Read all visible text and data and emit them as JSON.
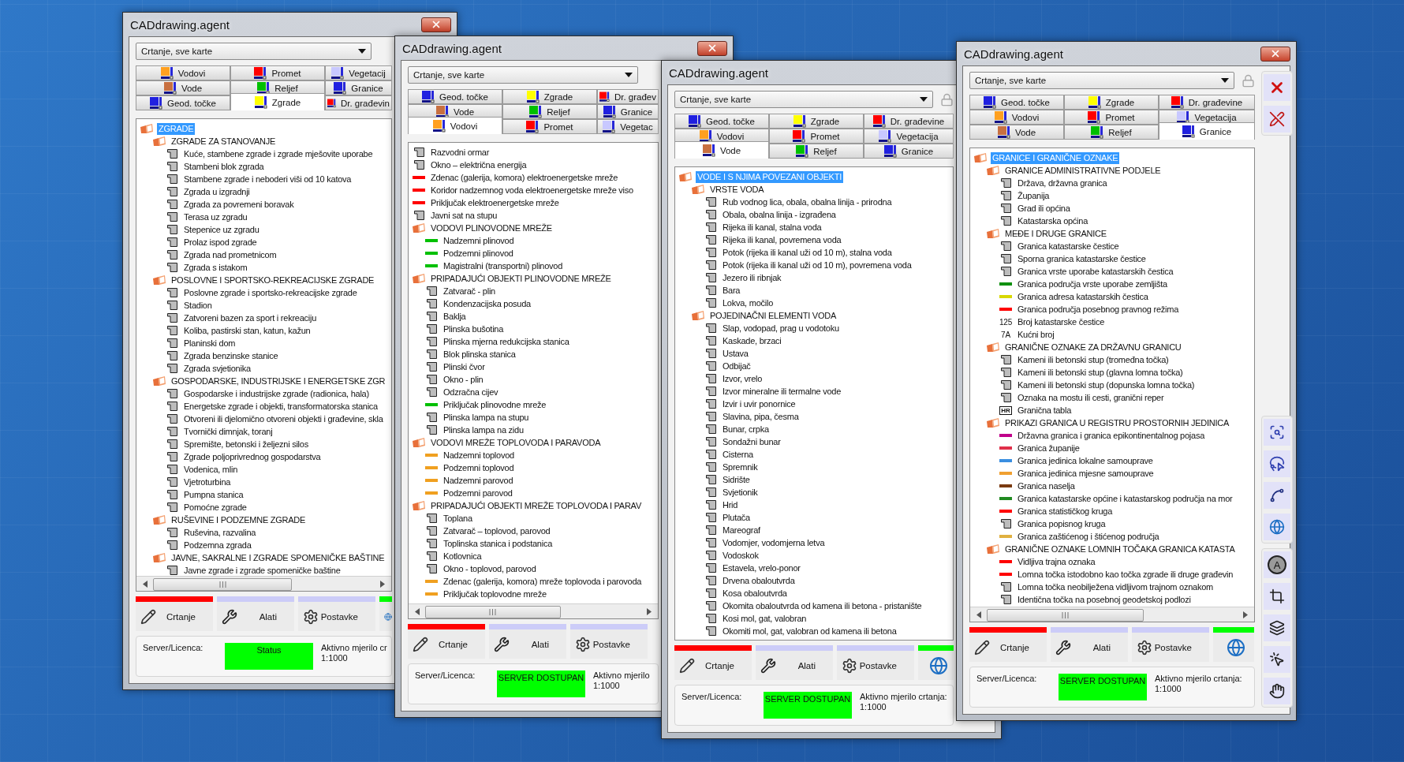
{
  "windows": [
    {
      "title": "CADdrawing.agent",
      "mode_select": {
        "value": "Crtanje, sve karte"
      },
      "tab_rows": [
        [
          {
            "label": "Vodovi",
            "color": "#ffa020",
            "selected": false
          },
          {
            "label": "Promet",
            "color": "#ff0000",
            "selected": false
          },
          {
            "label": "Vegetacij",
            "color": "#c8c8ff",
            "selected": false
          }
        ],
        [
          {
            "label": "Vode",
            "color": "#c87040",
            "selected": false
          },
          {
            "label": "Reljef",
            "color": "#00c000",
            "selected": false
          },
          {
            "label": "Granice",
            "color": "#2020e0",
            "selected": false
          }
        ],
        [
          {
            "label": "Geod. točke",
            "color": "#2020e0",
            "selected": false
          },
          {
            "label": "Zgrade",
            "color": "#ffff00",
            "selected": true
          },
          {
            "label": "Dr. građevin",
            "color": "#ff0000",
            "selected": false
          }
        ]
      ],
      "tree": [
        {
          "label": "ZGRADE",
          "selected": true,
          "children": [
            {
              "label": "ZGRADE ZA STANOVANJE",
              "selected": false,
              "children": [
                {
                  "label": "Kuće, stambene zgrade i zgrade mješovite uporabe",
                  "selected": false
                },
                {
                  "label": "Stambeni blok zgrada",
                  "selected": false
                },
                {
                  "label": "Stambene zgrade i neboderi viši od 10 katova",
                  "selected": false
                },
                {
                  "label": "Zgrada u izgradnji",
                  "selected": false
                },
                {
                  "label": "Zgrada za povremeni boravak",
                  "selected": false
                },
                {
                  "label": "Terasa uz zgradu",
                  "selected": false
                },
                {
                  "label": "Stepenice uz zgradu",
                  "selected": false
                },
                {
                  "label": "Prolaz ispod zgrade",
                  "selected": false
                },
                {
                  "label": "Zgrada nad prometnicom",
                  "selected": false
                },
                {
                  "label": "Zgrada s istakom",
                  "selected": false
                }
              ]
            },
            {
              "label": "POSLOVNE I SPORTSKO-REKREACIJSKE ZGRADE",
              "selected": false,
              "children": [
                {
                  "label": "Poslovne zgrade i sportsko-rekreacijske zgrade",
                  "selected": false
                },
                {
                  "label": "Stadion",
                  "selected": false
                },
                {
                  "label": "Zatvoreni bazen za sport i rekreaciju",
                  "selected": false
                },
                {
                  "label": "Koliba, pastirski stan, katun, kažun",
                  "selected": false
                },
                {
                  "label": "Planinski dom",
                  "selected": false
                },
                {
                  "label": "Zgrada benzinske stanice",
                  "selected": false
                },
                {
                  "label": "Zgrada svjetionika",
                  "selected": false
                }
              ]
            },
            {
              "label": "GOSPODARSKE, INDUSTRIJSKE I ENERGETSKE ZGR",
              "selected": false,
              "children": [
                {
                  "label": "Gospodarske i industrijske zgrade (radionica, hala)",
                  "selected": false
                },
                {
                  "label": "Energetske zgrade i objekti, transformatorska stanica",
                  "selected": false
                },
                {
                  "label": "Otvoreni ili djelomično otvoreni objekti i građevine, skla",
                  "selected": false
                },
                {
                  "label": "Tvornički dimnjak, toranj",
                  "selected": false
                },
                {
                  "label": "Spremište, betonski i željezni silos",
                  "selected": false
                },
                {
                  "label": "Zgrade poljoprivrednog gospodarstva",
                  "selected": false
                },
                {
                  "label": "Vodenica, mlin",
                  "selected": false
                },
                {
                  "label": "Vjetroturbina",
                  "selected": false
                },
                {
                  "label": "Pumpna stanica",
                  "selected": false
                },
                {
                  "label": "Pomoćne zgrade",
                  "selected": false
                }
              ]
            },
            {
              "label": "RUŠEVINE I PODZEMNE ZGRADE",
              "selected": false,
              "children": [
                {
                  "label": "Ruševina, razvalina",
                  "selected": false
                },
                {
                  "label": "Podzemna zgrada",
                  "selected": false
                }
              ]
            },
            {
              "label": "JAVNE, SAKRALNE I ZGRADE SPOMENIČKE BAŠTINE",
              "selected": false,
              "children": [
                {
                  "label": "Javne zgrade i zgrade spomeničke baštine",
                  "selected": false
                }
              ]
            }
          ]
        }
      ],
      "tree_scrollbar": true,
      "actions": [
        {
          "label": "Crtanje",
          "color": "#ff0000"
        },
        {
          "label": "Alati",
          "color": "#ccccf8"
        },
        {
          "label": "Postavke",
          "color": "#ccccf8"
        },
        {
          "color": "#00ff00"
        }
      ],
      "status": {
        "label": "Server/Licenca:",
        "value": "Status",
        "scale_label": "Aktivno mjerilo cr",
        "scale": "1:1000"
      }
    },
    {
      "title": "CADdrawing.agent",
      "mode_select": {
        "value": "Crtanje, sve karte"
      },
      "tab_rows": [
        [
          {
            "label": "Geod. točke",
            "color": "#2020e0",
            "selected": false
          },
          {
            "label": "Zgrade",
            "color": "#ffff00",
            "selected": false
          },
          {
            "label": "Dr. građev",
            "color": "#ff0000",
            "selected": false
          }
        ],
        [
          {
            "label": "Vode",
            "color": "#c87040",
            "selected": false
          },
          {
            "label": "Reljef",
            "color": "#00c000",
            "selected": false
          },
          {
            "label": "Granice",
            "color": "#2020e0",
            "selected": false
          }
        ],
        [
          {
            "label": "Vodovi",
            "color": "#ffa020",
            "selected": true
          },
          {
            "label": "Promet",
            "color": "#ff0000",
            "selected": false
          },
          {
            "label": "Vegetac",
            "color": "#c8c8ff",
            "selected": false
          }
        ]
      ],
      "tree": [
        {
          "label": "Razvodni ormar",
          "selected": false
        },
        {
          "label": "Okno – električna energija",
          "selected": false
        },
        {
          "label": "Zdenac (galerija, komora) elektroenergetske mreže",
          "selected": false,
          "color": "#ff0000"
        },
        {
          "label": "Koridor nadzemnog voda elektroenergetske mreže viso",
          "selected": false,
          "color": "#ff0000"
        },
        {
          "label": "Priključak elektroenergetske mreže",
          "selected": false,
          "color": "#ff0000"
        },
        {
          "label": "Javni sat na stupu",
          "selected": false
        },
        {
          "label": "VODOVI PLINOVODNE MREŽE",
          "selected": false,
          "children": [
            {
              "label": "Nadzemni plinovod",
              "selected": false,
              "color": "#00c000"
            },
            {
              "label": "Podzemni plinovod",
              "selected": false,
              "color": "#00c000"
            },
            {
              "label": "Magistralni (transportni) plinovod",
              "selected": false,
              "color": "#00c000"
            }
          ]
        },
        {
          "label": "PRIPADAJUĆI OBJEKTI PLINOVODNE MREŽE",
          "selected": false,
          "children": [
            {
              "label": "Zatvarač - plin",
              "selected": false
            },
            {
              "label": "Kondenzacijska posuda",
              "selected": false
            },
            {
              "label": "Baklja",
              "selected": false
            },
            {
              "label": "Plinska bušotina",
              "selected": false
            },
            {
              "label": "Plinska mjerna redukcijska stanica",
              "selected": false
            },
            {
              "label": "Blok plinska stanica",
              "selected": false
            },
            {
              "label": "Plinski čvor",
              "selected": false
            },
            {
              "label": "Okno - plin",
              "selected": false
            },
            {
              "label": "Odzračna cijev",
              "selected": false
            },
            {
              "label": "Priključak plinovodne mreže",
              "selected": false,
              "color": "#00c000"
            },
            {
              "label": "Plinska lampa na stupu",
              "selected": false
            },
            {
              "label": "Plinska lampa na zidu",
              "selected": false
            }
          ]
        },
        {
          "label": "VODOVI MREŽE TOPLOVODA I PARAVODA",
          "selected": false,
          "children": [
            {
              "label": "Nadzemni toplovod",
              "selected": false,
              "color": "#f0a020"
            },
            {
              "label": "Podzemni toplovod",
              "selected": false,
              "color": "#f0a020"
            },
            {
              "label": "Nadzemni parovod",
              "selected": false,
              "color": "#f0a020"
            },
            {
              "label": "Podzemni parovod",
              "selected": false,
              "color": "#f0a020"
            }
          ]
        },
        {
          "label": "PRIPADAJUĆI OBJEKTI MREŽE TOPLOVODA I PARAV",
          "selected": false,
          "children": [
            {
              "label": "Toplana",
              "selected": false
            },
            {
              "label": "Zatvarač – toplovod, parovod",
              "selected": false
            },
            {
              "label": "Toplinska stanica i podstanica",
              "selected": false
            },
            {
              "label": "Kotlovnica",
              "selected": false
            },
            {
              "label": "Okno - toplovod, parovod",
              "selected": false
            },
            {
              "label": "Zdenac (galerija, komora) mreže toplovoda i parovoda",
              "selected": false,
              "color": "#f0a020"
            },
            {
              "label": "Priključak toplovodne mreže",
              "selected": false,
              "color": "#f0a020"
            }
          ]
        }
      ],
      "tree_scrollbar": true,
      "actions": [
        {
          "label": "Crtanje",
          "color": "#ff0000"
        },
        {
          "label": "Alati",
          "color": "#ccccf8"
        },
        {
          "label": "Postavke",
          "color": "#ccccf8"
        }
      ],
      "status": {
        "label": "Server/Licenca:",
        "value": "SERVER DOSTUPAN",
        "scale_label": "Aktivno mjerilo",
        "scale": "1:1000"
      }
    },
    {
      "title": "CADdrawing.agent",
      "mode_select": {
        "value": "Crtanje, sve karte"
      },
      "locked": true,
      "tab_rows": [
        [
          {
            "label": "Geod. točke",
            "color": "#2020e0",
            "selected": false
          },
          {
            "label": "Zgrade",
            "color": "#ffff00",
            "selected": false
          },
          {
            "label": "Dr. građevine",
            "color": "#ff0000",
            "selected": false
          }
        ],
        [
          {
            "label": "Vodovi",
            "color": "#ffa020",
            "selected": false
          },
          {
            "label": "Promet",
            "color": "#ff0000",
            "selected": false
          },
          {
            "label": "Vegetacija",
            "color": "#c8c8ff",
            "selected": false
          }
        ],
        [
          {
            "label": "Vode",
            "color": "#c87040",
            "selected": true
          },
          {
            "label": "Reljef",
            "color": "#00c000",
            "selected": false
          },
          {
            "label": "Granice",
            "color": "#2020e0",
            "selected": false
          }
        ]
      ],
      "tree": [
        {
          "label": "VODE I S NJIMA POVEZANI OBJEKTI",
          "selected": true,
          "children": [
            {
              "label": "VRSTE VODA",
              "selected": false,
              "children": [
                {
                  "label": "Rub vodnog lica, obala, obalna linija - prirodna",
                  "selected": false
                },
                {
                  "label": "Obala, obalna linija - izgrađena",
                  "selected": false
                },
                {
                  "label": "Rijeka ili kanal, stalna voda",
                  "selected": false
                },
                {
                  "label": "Rijeka ili kanal, povremena voda",
                  "selected": false
                },
                {
                  "label": "Potok (rijeka ili kanal uži od 10 m), stalna voda",
                  "selected": false
                },
                {
                  "label": "Potok (rijeka ili kanal uži od 10 m), povremena voda",
                  "selected": false
                },
                {
                  "label": "Jezero ili ribnjak",
                  "selected": false
                },
                {
                  "label": "Bara",
                  "selected": false
                },
                {
                  "label": "Lokva, močilo",
                  "selected": false
                }
              ]
            },
            {
              "label": "POJEDINAČNI ELEMENTI VODA",
              "selected": false,
              "children": [
                {
                  "label": "Slap, vodopad, prag u vodotoku",
                  "selected": false
                },
                {
                  "label": "Kaskade, brzaci",
                  "selected": false
                },
                {
                  "label": "Ustava",
                  "selected": false
                },
                {
                  "label": "Odbijač",
                  "selected": false
                },
                {
                  "label": "Izvor, vrelo",
                  "selected": false
                },
                {
                  "label": "Izvor mineralne ili termalne vode",
                  "selected": false
                },
                {
                  "label": "Izvir i uvir ponornice",
                  "selected": false
                },
                {
                  "label": "Slavina, pipa, česma",
                  "selected": false
                },
                {
                  "label": "Bunar, crpka",
                  "selected": false
                },
                {
                  "label": "Sondažni bunar",
                  "selected": false
                },
                {
                  "label": "Cisterna",
                  "selected": false
                },
                {
                  "label": "Spremnik",
                  "selected": false
                },
                {
                  "label": "Sidrište",
                  "selected": false
                },
                {
                  "label": "Svjetionik",
                  "selected": false
                },
                {
                  "label": "Hrid",
                  "selected": false
                },
                {
                  "label": "Plutača",
                  "selected": false
                },
                {
                  "label": "Mareograf",
                  "selected": false
                },
                {
                  "label": "Vodomjer, vodomjerna letva",
                  "selected": false
                },
                {
                  "label": "Vodoskok",
                  "selected": false
                },
                {
                  "label": "Estavela, vrelo-ponor",
                  "selected": false
                },
                {
                  "label": "Drvena obaloutvrda",
                  "selected": false
                },
                {
                  "label": "Kosa obaloutvrda",
                  "selected": false
                },
                {
                  "label": "Okomita obaloutvrda od kamena ili betona - pristanište",
                  "selected": false
                },
                {
                  "label": "Kosi mol, gat, valobran",
                  "selected": false
                },
                {
                  "label": "Okomiti mol, gat, valobran od kamena ili betona",
                  "selected": false
                }
              ]
            }
          ]
        }
      ],
      "tree_scrollbar": false,
      "actions": [
        {
          "label": "Crtanje",
          "color": "#ff0000"
        },
        {
          "label": "Alati",
          "color": "#ccccf8"
        },
        {
          "label": "Postavke",
          "color": "#ccccf8"
        },
        {
          "color": "#00ff00"
        }
      ],
      "status": {
        "label": "Server/Licenca:",
        "value": "SERVER DOSTUPAN",
        "scale_label": "Aktivno mjerilo crtanja:",
        "scale": "1:1000"
      }
    },
    {
      "title": "CADdrawing.agent",
      "mode_select": {
        "value": "Crtanje, sve karte"
      },
      "locked": true,
      "tab_rows": [
        [
          {
            "label": "Geod. točke",
            "color": "#2020e0",
            "selected": false
          },
          {
            "label": "Zgrade",
            "color": "#ffff00",
            "selected": false
          },
          {
            "label": "Dr. građevine",
            "color": "#ff0000",
            "selected": false
          }
        ],
        [
          {
            "label": "Vodovi",
            "color": "#ffa020",
            "selected": false
          },
          {
            "label": "Promet",
            "color": "#ff0000",
            "selected": false
          },
          {
            "label": "Vegetacija",
            "color": "#c8c8ff",
            "selected": false
          }
        ],
        [
          {
            "label": "Vode",
            "color": "#c87040",
            "selected": false
          },
          {
            "label": "Reljef",
            "color": "#00c000",
            "selected": false
          },
          {
            "label": "Granice",
            "color": "#2020e0",
            "selected": true
          }
        ]
      ],
      "tree": [
        {
          "label": "GRANICE I GRANIČNE OZNAKE",
          "selected": true,
          "children": [
            {
              "label": "GRANICE ADMINISTRATIVNE PODJELE",
              "selected": false,
              "children": [
                {
                  "label": "Država, državna granica",
                  "selected": false
                },
                {
                  "label": "Županija",
                  "selected": false
                },
                {
                  "label": "Grad ili općina",
                  "selected": false
                },
                {
                  "label": "Katastarska općina",
                  "selected": false
                }
              ]
            },
            {
              "label": "MEĐE I DRUGE GRANICE",
              "selected": false,
              "children": [
                {
                  "label": "Granica katastarske čestice",
                  "selected": false
                },
                {
                  "label": "Sporna granica katastarske čestice",
                  "selected": false
                },
                {
                  "label": "Granica vrste uporabe katastarskih čestica",
                  "selected": false
                },
                {
                  "label": "Granica područja vrste uporabe zemljišta",
                  "selected": false,
                  "color": "#109010"
                },
                {
                  "label": "Granica adresa katastarskih čestica",
                  "selected": false,
                  "color": "#d8d800"
                },
                {
                  "label": "Granica područja posebnog pravnog režima",
                  "selected": false,
                  "color": "#ff0000"
                },
                {
                  "label": "Broj katastarske čestice",
                  "selected": false,
                  "symbol_text": "125"
                },
                {
                  "label": "Kućni broj",
                  "selected": false,
                  "symbol_text": "7A"
                }
              ]
            },
            {
              "label": "GRANIČNE OZNAKE ZA DRŽAVNU GRANICU",
              "selected": false,
              "children": [
                {
                  "label": "Kameni ili betonski stup (tromeđna točka)",
                  "selected": false
                },
                {
                  "label": "Kameni ili betonski stup (glavna lomna točka)",
                  "selected": false
                },
                {
                  "label": "Kameni ili betonski stup (dopunska lomna točka)",
                  "selected": false
                },
                {
                  "label": "Oznaka na mostu ili cesti, granični reper",
                  "selected": false
                },
                {
                  "label": "Granična tabla",
                  "selected": false,
                  "symbol_text": "HR"
                }
              ]
            },
            {
              "label": "PRIKAZI GRANICA U REGISTRU PROSTORNIH JEDINICA",
              "selected": false,
              "children": [
                {
                  "label": "Državna granica i granica epikontinentalnog pojasa",
                  "selected": false,
                  "color": "#c0008a"
                },
                {
                  "label": "Granica županije",
                  "selected": false,
                  "color": "#e0304a"
                },
                {
                  "label": "Granica jedinica lokalne samouprave",
                  "selected": false,
                  "color": "#3a8ee0"
                },
                {
                  "label": "Granica jedinica mjesne samouprave",
                  "selected": false,
                  "color": "#f0a030"
                },
                {
                  "label": "Granica naselja",
                  "selected": false,
                  "color": "#7a3a10"
                },
                {
                  "label": "Granica katastarske općine i katastarskog područja na mor",
                  "selected": false,
                  "color": "#208a20"
                },
                {
                  "label": "Granica statističkog kruga",
                  "selected": false,
                  "color": "#ff0000"
                },
                {
                  "label": "Granica popisnog kruga",
                  "selected": false
                },
                {
                  "label": "Granica zaštićenog i štićenog područja",
                  "selected": false,
                  "color": "#e0b040"
                }
              ]
            },
            {
              "label": "GRANIČNE OZNAKE LOMNIH TOČAKA GRANICA KATASTA",
              "selected": false,
              "children": [
                {
                  "label": "Vidljiva trajna oznaka",
                  "selected": false,
                  "color": "#ff0000"
                },
                {
                  "label": "Lomna točka istodobno kao točka zgrade ili druge građevin",
                  "selected": false,
                  "color": "#ff0000"
                },
                {
                  "label": "Lomna točka neobilježena vidljivom trajnom oznakom",
                  "selected": false
                },
                {
                  "label": "Identična točka na posebnoj geodetskoj podlozi",
                  "selected": false
                }
              ]
            }
          ]
        }
      ],
      "tree_scrollbar": true,
      "actions": [
        {
          "label": "Crtanje",
          "color": "#ff0000"
        },
        {
          "label": "Alati",
          "color": "#ccccf8"
        },
        {
          "label": "Postavke",
          "color": "#ccccf8"
        },
        {
          "color": "#00ff00"
        }
      ],
      "status": {
        "label": "Server/Licenca:",
        "value": "SERVER DOSTUPAN",
        "scale_label": "Aktivno mjerilo crtanja:",
        "scale": "1:1000"
      },
      "toolbar": {
        "letter_button": "A"
      }
    }
  ]
}
